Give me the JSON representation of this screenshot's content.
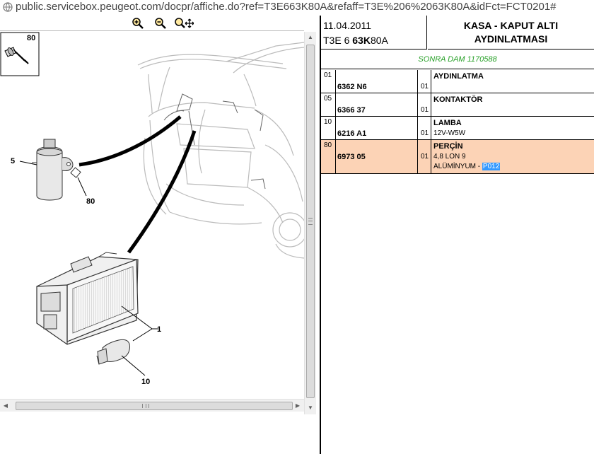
{
  "browser": {
    "url": "public.servicebox.peugeot.com/docpr/affiche.do?ref=T3E663K80A&refaff=T3E%206%2063K80A&idFct=FCT0201#"
  },
  "drawing": {
    "labels": {
      "inset": "80",
      "p5": "5",
      "p80": "80",
      "p1": "1",
      "p10": "10"
    }
  },
  "header": {
    "date": "11.04.2011",
    "ref_prefix": "T3E 6",
    "ref_bold": "63K",
    "ref_suffix": "80A",
    "title_line1": "KASA - KAPUT ALTI",
    "title_line2": "AYDINLATMASI",
    "note": "SONRA DAM 1170588"
  },
  "parts": [
    {
      "pos": "01",
      "ref": "6362 N6",
      "qty": "01",
      "name": "AYDINLATMA",
      "desc1": "",
      "desc2": ""
    },
    {
      "pos": "05",
      "ref": "6366 37",
      "qty": "01",
      "name": "KONTAKTÖR",
      "desc1": "",
      "desc2": ""
    },
    {
      "pos": "10",
      "ref": "6216 A1",
      "qty": "01",
      "name": "LAMBA",
      "desc1": "12V-W5W",
      "desc2": ""
    },
    {
      "pos": "80",
      "ref": "6973 05",
      "qty": "01",
      "name": "PERÇİN",
      "desc1": "4,8 LON 9",
      "desc2_prefix": "ALÜMİNYUM - ",
      "desc2_selected": "P012"
    }
  ],
  "colors": {
    "highlight_row": "#fcd3b6",
    "note_text": "#27a027",
    "selection": "#3399ff"
  }
}
